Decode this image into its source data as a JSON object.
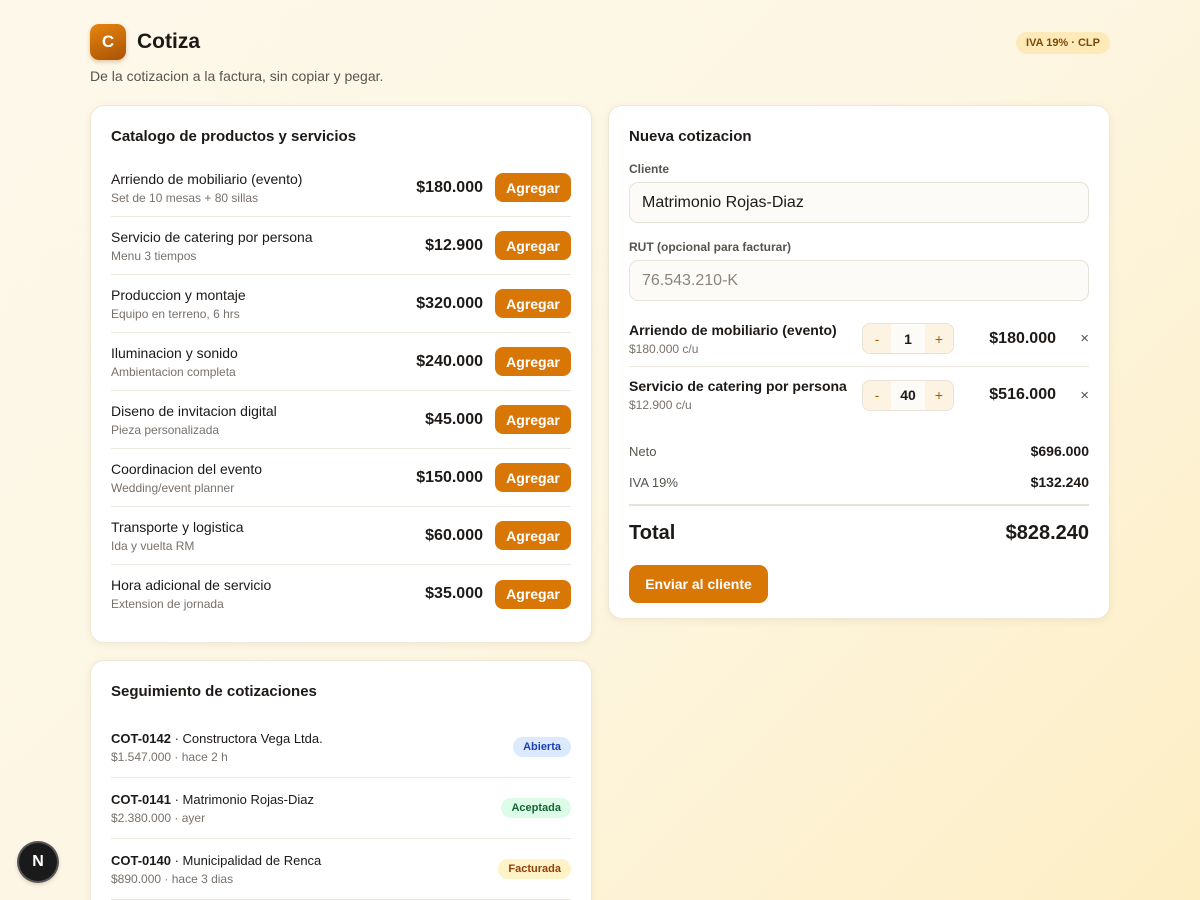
{
  "app": {
    "logo_letter": "C",
    "name": "Cotiza",
    "tagline": "De la cotizacion a la factura, sin copiar y pegar.",
    "iva_badge": "IVA 19% · CLP"
  },
  "catalog": {
    "title": "Catalogo de productos y servicios",
    "add_label": "Agregar",
    "items": [
      {
        "name": "Arriendo de mobiliario (evento)",
        "desc": "Set de 10 mesas + 80 sillas",
        "price": "$180.000"
      },
      {
        "name": "Servicio de catering por persona",
        "desc": "Menu 3 tiempos",
        "price": "$12.900"
      },
      {
        "name": "Produccion y montaje",
        "desc": "Equipo en terreno, 6 hrs",
        "price": "$320.000"
      },
      {
        "name": "Iluminacion y sonido",
        "desc": "Ambientacion completa",
        "price": "$240.000"
      },
      {
        "name": "Diseno de invitacion digital",
        "desc": "Pieza personalizada",
        "price": "$45.000"
      },
      {
        "name": "Coordinacion del evento",
        "desc": "Wedding/event planner",
        "price": "$150.000"
      },
      {
        "name": "Transporte y logistica",
        "desc": "Ida y vuelta RM",
        "price": "$60.000"
      },
      {
        "name": "Hora adicional de servicio",
        "desc": "Extension de jornada",
        "price": "$35.000"
      }
    ]
  },
  "quote": {
    "title": "Nueva cotizacion",
    "client_label": "Cliente",
    "client_value": "Matrimonio Rojas-Diaz",
    "rut_label": "RUT (opcional para facturar)",
    "rut_placeholder": "76.543.210-K",
    "minus": "-",
    "plus": "+",
    "remove": "×",
    "lines": [
      {
        "name": "Arriendo de mobiliario (evento)",
        "unit": "$180.000 c/u",
        "qty": "1",
        "total": "$180.000"
      },
      {
        "name": "Servicio de catering por persona",
        "unit": "$12.900 c/u",
        "qty": "40",
        "total": "$516.000"
      }
    ],
    "neto_label": "Neto",
    "neto_value": "$696.000",
    "iva_label": "IVA 19%",
    "iva_value": "$132.240",
    "total_label": "Total",
    "total_value": "$828.240",
    "send_label": "Enviar al cliente"
  },
  "tracking": {
    "title": "Seguimiento de cotizaciones",
    "items": [
      {
        "id": "COT-0142",
        "client": " · Constructora Vega Ltda.",
        "meta": "$1.547.000 · hace 2 h",
        "status": "Abierta",
        "status_bg": "#dbeafe",
        "status_color": "#1e40af"
      },
      {
        "id": "COT-0141",
        "client": " · Matrimonio Rojas-Diaz",
        "meta": "$2.380.000 · ayer",
        "status": "Aceptada",
        "status_bg": "#dcfce7",
        "status_color": "#166534"
      },
      {
        "id": "COT-0140",
        "client": " · Municipalidad de Renca",
        "meta": "$890.000 · hace 3 dias",
        "status": "Facturada",
        "status_bg": "#fef3c7",
        "status_color": "#92400e"
      }
    ]
  },
  "dev_badge": {
    "letter": "N"
  }
}
